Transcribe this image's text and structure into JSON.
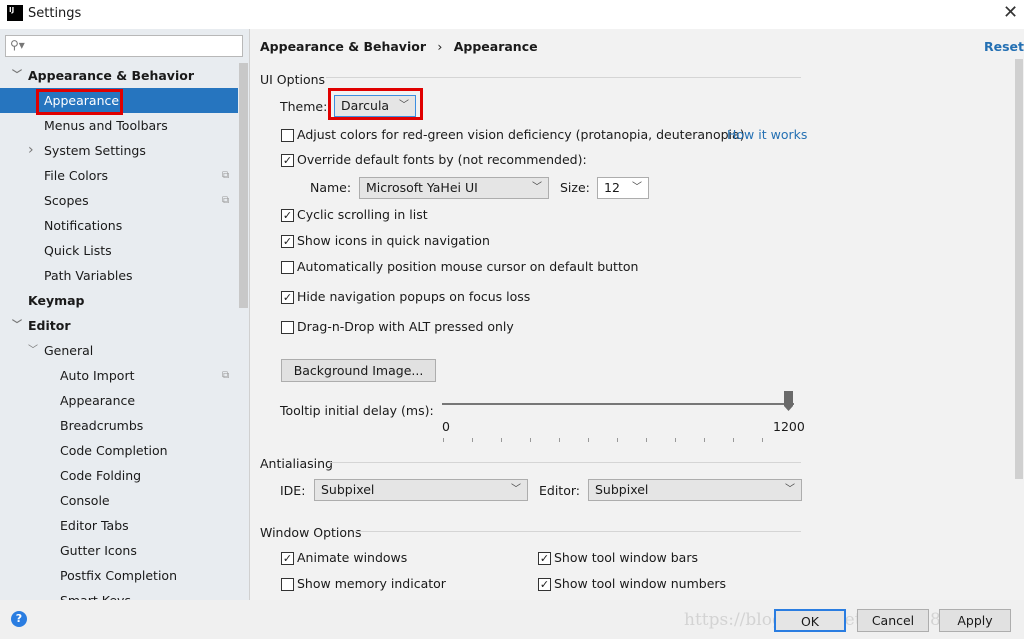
{
  "window": {
    "title": "Settings",
    "icon": "intellij-logo-icon",
    "close_icon": "close-icon"
  },
  "search": {
    "placeholder": "",
    "icon": "search-icon"
  },
  "sidebar": {
    "items": [
      {
        "label": "Appearance & Behavior",
        "level": 0,
        "bold": true,
        "expanded": true
      },
      {
        "label": "Appearance",
        "level": 1,
        "selected": true
      },
      {
        "label": "Menus and Toolbars",
        "level": 1
      },
      {
        "label": "System Settings",
        "level": 1,
        "expandable": true
      },
      {
        "label": "File Colors",
        "level": 1,
        "project_icon": true
      },
      {
        "label": "Scopes",
        "level": 1,
        "project_icon": true
      },
      {
        "label": "Notifications",
        "level": 1
      },
      {
        "label": "Quick Lists",
        "level": 1
      },
      {
        "label": "Path Variables",
        "level": 1
      },
      {
        "label": "Keymap",
        "level": 0,
        "bold": true
      },
      {
        "label": "Editor",
        "level": 0,
        "bold": true,
        "expanded": true
      },
      {
        "label": "General",
        "level": 1,
        "expanded": true
      },
      {
        "label": "Auto Import",
        "level": 2,
        "project_icon": true
      },
      {
        "label": "Appearance",
        "level": 2
      },
      {
        "label": "Breadcrumbs",
        "level": 2
      },
      {
        "label": "Code Completion",
        "level": 2
      },
      {
        "label": "Code Folding",
        "level": 2
      },
      {
        "label": "Console",
        "level": 2
      },
      {
        "label": "Editor Tabs",
        "level": 2
      },
      {
        "label": "Gutter Icons",
        "level": 2
      },
      {
        "label": "Postfix Completion",
        "level": 2
      },
      {
        "label": "Smart Keys",
        "level": 2
      }
    ]
  },
  "breadcrumb": {
    "parent": "Appearance & Behavior",
    "separator": "›",
    "current": "Appearance"
  },
  "reset_label": "Reset",
  "ui_options": {
    "title": "UI Options",
    "theme_label": "Theme:",
    "theme_value": "Darcula",
    "adjust_colors": {
      "label": "Adjust colors for red-green vision deficiency (protanopia, deuteranopia)",
      "checked": false
    },
    "how_it_works": "How it works",
    "override_fonts": {
      "label": "Override default fonts by (not recommended):",
      "checked": true
    },
    "name_label": "Name:",
    "name_value": "Microsoft YaHei UI",
    "size_label": "Size:",
    "size_value": "12",
    "checkboxes": [
      {
        "label": "Cyclic scrolling in list",
        "checked": true
      },
      {
        "label": "Show icons in quick navigation",
        "checked": true
      },
      {
        "label": "Automatically position mouse cursor on default button",
        "checked": false
      },
      {
        "label": "Hide navigation popups on focus loss",
        "checked": true
      },
      {
        "label": "Drag-n-Drop with ALT pressed only",
        "checked": false
      }
    ],
    "background_image_button": "Background Image...",
    "tooltip_label": "Tooltip initial delay (ms):",
    "tooltip_min": "0",
    "tooltip_max": "1200",
    "tooltip_value": 1200
  },
  "antialiasing": {
    "title": "Antialiasing",
    "ide_label": "IDE:",
    "ide_value": "Subpixel",
    "editor_label": "Editor:",
    "editor_value": "Subpixel"
  },
  "window_options": {
    "title": "Window Options",
    "items": [
      {
        "label": "Animate windows",
        "checked": true
      },
      {
        "label": "Show tool window bars",
        "checked": true
      },
      {
        "label": "Show memory indicator",
        "checked": false
      },
      {
        "label": "Show tool window numbers",
        "checked": true
      }
    ]
  },
  "footer": {
    "ok": "OK",
    "cancel": "Cancel",
    "apply": "Apply",
    "help_icon": "help-icon",
    "watermark": "https://blog.csdn.net/qq_26981333"
  },
  "colors": {
    "accent": "#2675bf",
    "highlight": "#e00000",
    "link": "#2470b3"
  }
}
